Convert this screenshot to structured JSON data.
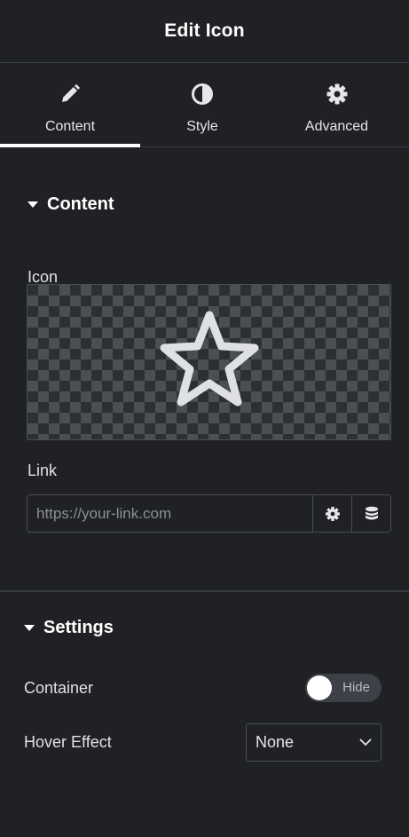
{
  "header": {
    "title": "Edit Icon"
  },
  "tabs": [
    {
      "label": "Content",
      "icon": "pencil-icon",
      "active": true
    },
    {
      "label": "Style",
      "icon": "contrast-icon",
      "active": false
    },
    {
      "label": "Advanced",
      "icon": "gear-icon",
      "active": false
    }
  ],
  "content_section": {
    "title": "Content",
    "icon_label": "Icon",
    "selected_icon": "star-icon",
    "link_label": "Link",
    "link_placeholder": "https://your-link.com",
    "link_value": ""
  },
  "settings_section": {
    "title": "Settings",
    "container_label": "Container",
    "container_toggle_text": "Hide",
    "hover_label": "Hover Effect",
    "hover_value": "None"
  },
  "colors": {
    "background": "#1f2124",
    "text": "#e0e1e3",
    "border": "#4a4d52",
    "active_tab": "#ffffff"
  }
}
